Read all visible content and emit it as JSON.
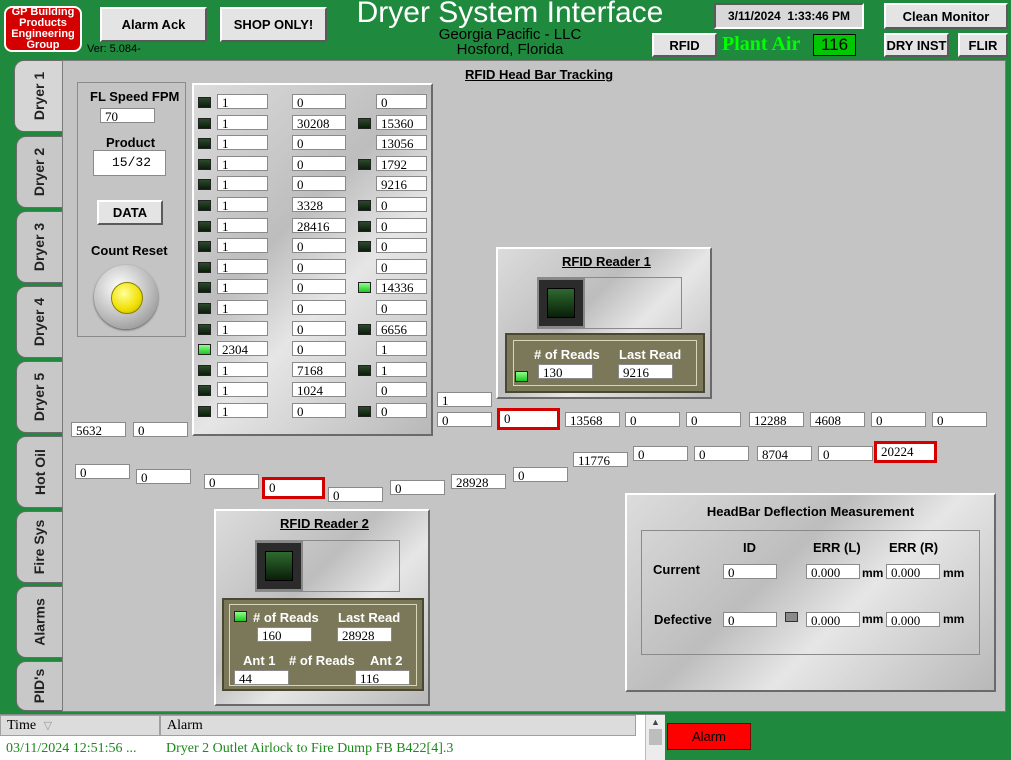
{
  "header": {
    "logo": [
      "GP Building",
      "Products",
      "Engineering",
      "Group"
    ],
    "version": "Ver: 5.084-",
    "alarm_ack": "Alarm Ack",
    "shop_only": "SHOP ONLY!",
    "title": "Dryer System Interface",
    "company": "Georgia Pacific - LLC",
    "location": "Hosford, Florida",
    "datetime": "3/11/2024  1:33:46 PM",
    "clean_monitor": "Clean Monitor",
    "rfid": "RFID",
    "plant_air_label": "Plant Air",
    "plant_air_value": "116",
    "dry_inst": "DRY INST",
    "flir": "FLIR"
  },
  "tabs": [
    "Dryer 1",
    "Dryer 2",
    "Dryer 3",
    "Dryer 4",
    "Dryer 5",
    "Hot Oil",
    "Fire Sys",
    "Alarms",
    "PID's"
  ],
  "main": {
    "title": "RFID Head Bar Tracking",
    "fl_speed_label": "FL Speed FPM",
    "fl_speed_value": "70",
    "product_label": "Product",
    "product_value": "15/32",
    "data_button": "DATA",
    "count_reset_label": "Count Reset"
  },
  "grid": {
    "led1": [
      false,
      false,
      false,
      false,
      false,
      false,
      false,
      false,
      false,
      false,
      false,
      false,
      true,
      false,
      false,
      false
    ],
    "col1": [
      "1",
      "1",
      "1",
      "1",
      "1",
      "1",
      "1",
      "1",
      "1",
      "1",
      "1",
      "1",
      "2304",
      "1",
      "1",
      "1"
    ],
    "col2": [
      "0",
      "30208",
      "0",
      "0",
      "0",
      "3328",
      "28416",
      "0",
      "0",
      "0",
      "0",
      "0",
      "0",
      "7168",
      "1024",
      "0"
    ],
    "led3": [
      null,
      true,
      null,
      true,
      null,
      true,
      true,
      true,
      null,
      "on",
      null,
      true,
      null,
      true,
      null,
      true
    ],
    "col3": [
      "0",
      "15360",
      "13056",
      "1792",
      "9216",
      "0",
      "0",
      "0",
      "0",
      "14336",
      "0",
      "6656",
      "1",
      "1",
      "0",
      "0"
    ]
  },
  "reader1": {
    "title": "RFID Reader 1",
    "reads_label": "# of Reads",
    "last_label": "Last Read",
    "reads": "130",
    "last": "9216"
  },
  "reader2": {
    "title": "RFID Reader 2",
    "reads_label": "# of Reads",
    "last_label": "Last Read",
    "reads": "160",
    "last": "28928",
    "ant1_label": "Ant 1",
    "ant_reads_label": "# of Reads",
    "ant2_label": "Ant 2",
    "ant1": "44",
    "ant2": "116"
  },
  "track": {
    "a": "1",
    "b": "0",
    "c": "0",
    "d": "13568",
    "e": "0",
    "f": "0",
    "g": "12288",
    "h": "4608",
    "i": "0",
    "j": "0",
    "k": "5632",
    "l": "0",
    "m": "11776",
    "n": "0",
    "o": "0",
    "p": "8704",
    "q": "0",
    "r": "20224",
    "s": "0",
    "t": "0",
    "u": "0",
    "v": "0",
    "w": "0",
    "x": "0",
    "y": "28928",
    "z": "0"
  },
  "deflection": {
    "title": "HeadBar Deflection Measurement",
    "id_label": "ID",
    "errl_label": "ERR (L)",
    "errr_label": "ERR (R)",
    "current_label": "Current",
    "defective_label": "Defective",
    "current_id": "0",
    "current_l": "0.000",
    "current_r": "0.000",
    "defective_id": "0",
    "defective_l": "0.000",
    "defective_r": "0.000",
    "unit": "mm"
  },
  "alarm_bar": {
    "time_header": "Time",
    "alarm_header": "Alarm",
    "row_time": "03/11/2024 12:51:56 ...",
    "row_text": "Dryer 2 Outlet Airlock to Fire Dump FB B422[4].3",
    "alarm_button": "Alarm"
  },
  "colors": {
    "bg": "#1f8a3e",
    "alarm": "#ff0000",
    "plant_air": "#00ff00",
    "row_text": "#1a8a1a"
  }
}
